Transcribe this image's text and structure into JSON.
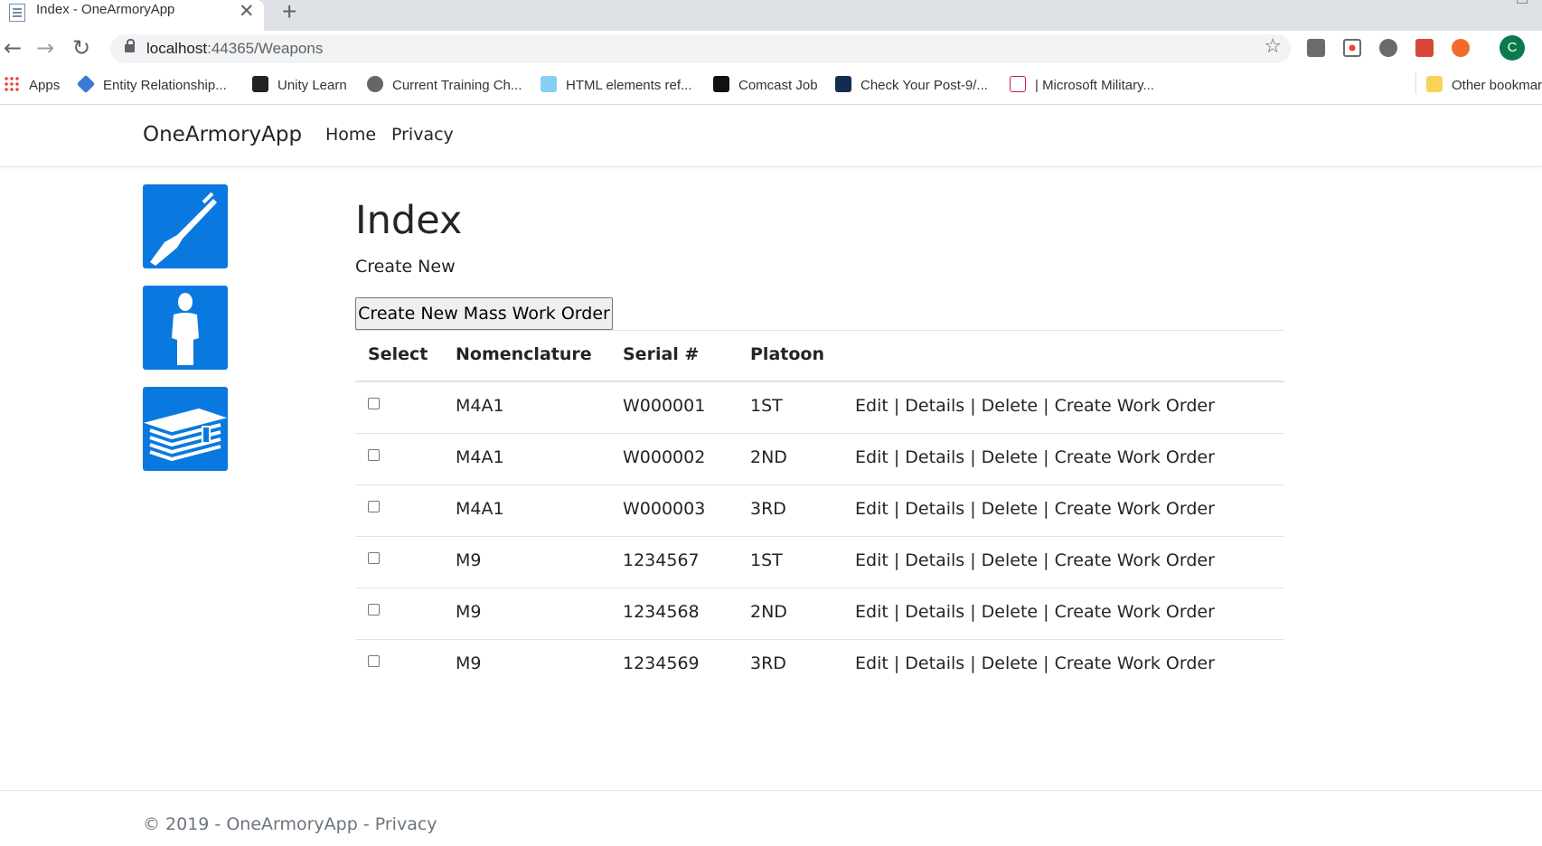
{
  "browser": {
    "tab_title": "Index - OneArmoryApp",
    "tab_close": "✕",
    "new_tab": "+",
    "url_host": "localhost",
    "url_rest": ":44365/Weapons",
    "profile_initial": "C",
    "bookmarks": [
      {
        "label": "Apps",
        "icon": "apps-grid-icon"
      },
      {
        "label": "Entity Relationship...",
        "icon": "diamond-icon"
      },
      {
        "label": "Unity Learn",
        "icon": "unity-icon"
      },
      {
        "label": "Current Training Ch...",
        "icon": "globe-icon"
      },
      {
        "label": "HTML elements ref...",
        "icon": "mdn-icon"
      },
      {
        "label": "Comcast Job",
        "icon": "c-icon"
      },
      {
        "label": "Check Your Post-9/...",
        "icon": "va-icon"
      },
      {
        "label": "| Microsoft Military...",
        "icon": "edx-icon"
      },
      {
        "label": "Other bookmarks",
        "icon": "folder-icon"
      }
    ]
  },
  "navbar": {
    "brand": "OneArmoryApp",
    "links": [
      "Home",
      "Privacy"
    ]
  },
  "sidebar": {
    "tiles": [
      "rifle-icon",
      "person-icon",
      "books-icon"
    ],
    "accent": "#0a79df"
  },
  "main": {
    "title": "Index",
    "create_new": "Create New",
    "mass_button": "Create New Mass Work Order",
    "columns": [
      "Select",
      "Nomenclature",
      "Serial #",
      "Platoon"
    ],
    "actions": [
      "Edit",
      "Details",
      "Delete",
      "Create Work Order"
    ],
    "separator": "|",
    "rows": [
      {
        "nomenclature": "M4A1",
        "serial": "W000001",
        "platoon": "1ST"
      },
      {
        "nomenclature": "M4A1",
        "serial": "W000002",
        "platoon": "2ND"
      },
      {
        "nomenclature": "M4A1",
        "serial": "W000003",
        "platoon": "3RD"
      },
      {
        "nomenclature": "M9",
        "serial": "1234567",
        "platoon": "1ST"
      },
      {
        "nomenclature": "M9",
        "serial": "1234568",
        "platoon": "2ND"
      },
      {
        "nomenclature": "M9",
        "serial": "1234569",
        "platoon": "3RD"
      }
    ]
  },
  "footer": {
    "text": "© 2019 - OneArmoryApp - ",
    "link": "Privacy"
  }
}
